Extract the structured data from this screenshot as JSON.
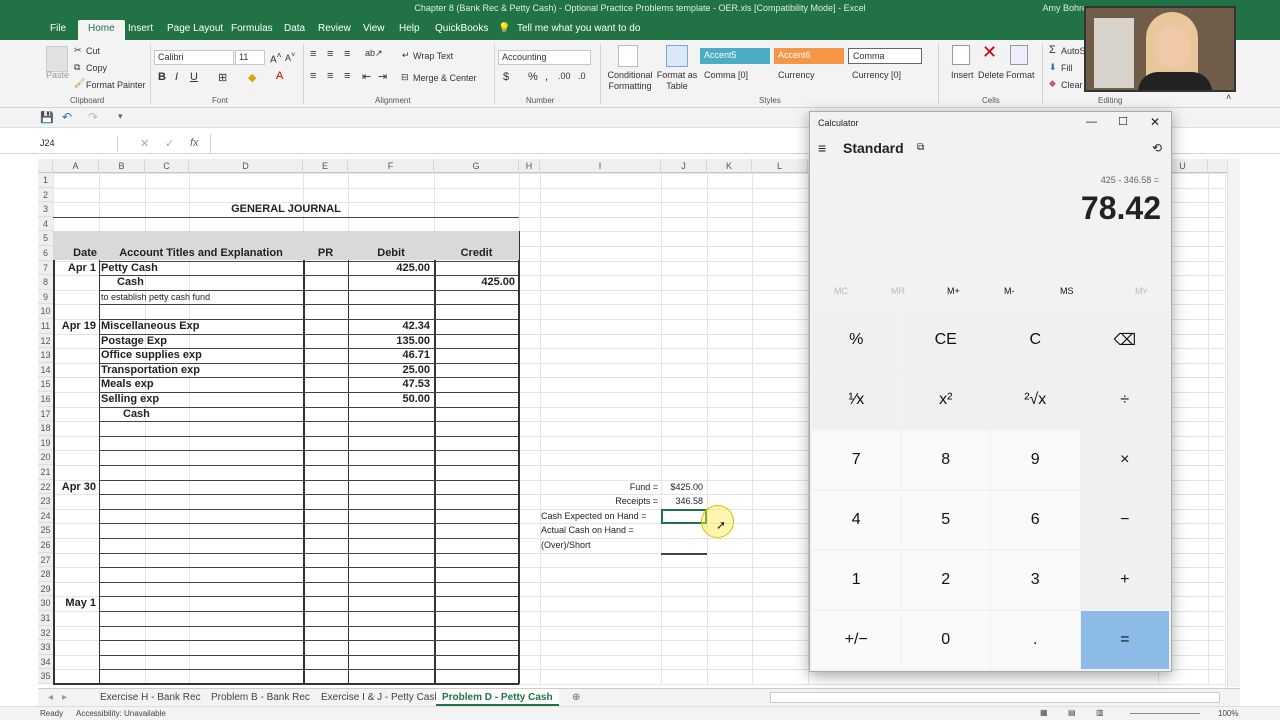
{
  "excel": {
    "title": "Chapter 8 (Bank Rec & Petty Cash) - Optional Practice Problems template - OER.xls  [Compatibility Mode]  -  Excel",
    "user": "Amy Bohrer",
    "tabs": [
      "File",
      "Home",
      "Insert",
      "Page Layout",
      "Formulas",
      "Data",
      "Review",
      "View",
      "Help",
      "QuickBooks"
    ],
    "tell_me": "Tell me what you want to do",
    "ribbon": {
      "clipboard": {
        "paste": "Paste",
        "cut": "Cut",
        "copy": "Copy",
        "format_painter": "Format Painter",
        "label": "Clipboard"
      },
      "font": {
        "name": "Calibri",
        "size": "11",
        "label": "Font"
      },
      "alignment": {
        "wrap": "Wrap Text",
        "merge": "Merge & Center",
        "label": "Alignment"
      },
      "number": {
        "format": "Accounting",
        "label": "Number"
      },
      "styles": {
        "cond": "Conditional Formatting",
        "table": "Format as Table",
        "cells": [
          "Accent5",
          "Accent6",
          "Comma",
          "Comma [0]",
          "Currency",
          "Currency [0]"
        ],
        "label": "Styles"
      },
      "cells": {
        "insert": "Insert",
        "delete": "Delete",
        "format": "Format",
        "label": "Cells"
      },
      "editing": {
        "autosum": "AutoS",
        "fill": "Fill",
        "clear": "Clear",
        "label": "Editing"
      }
    },
    "name_box": "J24",
    "columns": [
      "A",
      "B",
      "C",
      "D",
      "E",
      "F",
      "G",
      "H",
      "I",
      "J",
      "K",
      "L",
      "U"
    ],
    "rows": [
      "1",
      "2",
      "3",
      "4",
      "5",
      "6",
      "7",
      "8",
      "9",
      "10",
      "11",
      "12",
      "13",
      "14",
      "15",
      "16",
      "17",
      "18",
      "19",
      "20",
      "21",
      "22",
      "23",
      "24",
      "25",
      "26",
      "27",
      "28",
      "29",
      "30",
      "31",
      "32",
      "33",
      "34",
      "35"
    ],
    "journal": {
      "title": "GENERAL JOURNAL",
      "headers": {
        "date": "Date",
        "account": "Account Titles and Explanation",
        "pr": "PR",
        "debit": "Debit",
        "credit": "Credit"
      },
      "entries": [
        {
          "row": 7,
          "date": "Apr 1",
          "account": "Petty Cash",
          "debit": "425.00",
          "credit": "",
          "indent": false,
          "bold": true
        },
        {
          "row": 8,
          "date": "",
          "account": "Cash",
          "debit": "",
          "credit": "425.00",
          "indent": true,
          "bold": true
        },
        {
          "row": 9,
          "date": "",
          "account": "to establish petty cash fund",
          "debit": "",
          "credit": "",
          "indent": false,
          "bold": false
        },
        {
          "row": 11,
          "date": "Apr 19",
          "account": "Miscellaneous Exp",
          "debit": "42.34",
          "credit": "",
          "indent": false,
          "bold": true
        },
        {
          "row": 12,
          "date": "",
          "account": "Postage Exp",
          "debit": "135.00",
          "credit": "",
          "indent": false,
          "bold": true
        },
        {
          "row": 13,
          "date": "",
          "account": "Office supplies exp",
          "debit": "46.71",
          "credit": "",
          "indent": false,
          "bold": true
        },
        {
          "row": 14,
          "date": "",
          "account": "Transportation exp",
          "debit": "25.00",
          "credit": "",
          "indent": false,
          "bold": true
        },
        {
          "row": 15,
          "date": "",
          "account": "Meals exp",
          "debit": "47.53",
          "credit": "",
          "indent": false,
          "bold": true
        },
        {
          "row": 16,
          "date": "",
          "account": "Selling exp",
          "debit": "50.00",
          "credit": "",
          "indent": false,
          "bold": true
        },
        {
          "row": 17,
          "date": "",
          "account": "Cash",
          "debit": "",
          "credit": "",
          "indent": true,
          "bold": true
        },
        {
          "row": 22,
          "date": "Apr 30",
          "account": "",
          "debit": "",
          "credit": "",
          "indent": false,
          "bold": true
        },
        {
          "row": 30,
          "date": "May 1",
          "account": "",
          "debit": "",
          "credit": "",
          "indent": false,
          "bold": true
        }
      ]
    },
    "recon": [
      {
        "row": 22,
        "label": "Fund =",
        "value": "$425.00"
      },
      {
        "row": 23,
        "label": "Receipts =",
        "value": "346.58"
      },
      {
        "row": 24,
        "label": "Cash Expected on Hand =",
        "value": ""
      },
      {
        "row": 25,
        "label": "Actual Cash on Hand =",
        "value": ""
      },
      {
        "row": 26,
        "label": "(Over)/Short",
        "value": ""
      }
    ],
    "sheet_tabs": [
      "Exercise H - Bank Rec",
      "Problem B - Bank Rec",
      "Exercise I & J - Petty Cash",
      "Problem D - Petty Cash"
    ],
    "active_sheet": "Problem D - Petty Cash",
    "status": {
      "ready": "Ready",
      "accessibility": "Accessibility: Unavailable",
      "zoom": "100%"
    }
  },
  "calculator": {
    "title": "Calculator",
    "mode": "Standard",
    "expression": "425 - 346.58 =",
    "display": "78.42",
    "memory": [
      "MC",
      "MR",
      "M+",
      "M-",
      "MS",
      "M˅"
    ],
    "keys": [
      [
        "%",
        "CE",
        "C",
        "⌫"
      ],
      [
        "¹⁄x",
        "x²",
        "²√x",
        "÷"
      ],
      [
        "7",
        "8",
        "9",
        "×"
      ],
      [
        "4",
        "5",
        "6",
        "−"
      ],
      [
        "1",
        "2",
        "3",
        "+"
      ],
      [
        "+/−",
        "0",
        ".",
        "="
      ]
    ]
  },
  "colors": {
    "excel_green": "#217346",
    "equals_blue": "#8bbbe6",
    "tab_active": "#217346"
  }
}
